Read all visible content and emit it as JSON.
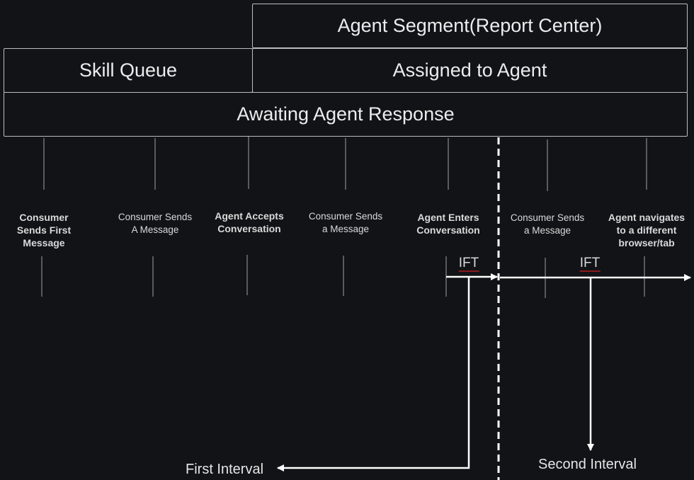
{
  "boxes": {
    "agent_segment": "Agent Segment(Report Center)",
    "skill_queue": "Skill Queue",
    "assigned_to_agent": "Assigned to Agent",
    "awaiting_agent_response": "Awaiting Agent Response"
  },
  "events": [
    {
      "line1": "Consumer",
      "line2": "Sends First",
      "line3": "Message",
      "bold": true
    },
    {
      "line1": "Consumer Sends",
      "line2": "A Message",
      "bold": false
    },
    {
      "line1": "Agent Accepts",
      "line2": "Conversation",
      "bold": true
    },
    {
      "line1": "Consumer Sends",
      "line2": "a Message",
      "bold": false
    },
    {
      "line1": "Agent Enters",
      "line2": "Conversation",
      "bold": true
    },
    {
      "line1": "Consumer Sends",
      "line2": "a Message",
      "bold": false
    },
    {
      "line1": "Agent navigates",
      "line2": "to a different",
      "line3": "browser/tab",
      "bold": true
    }
  ],
  "ift_labels": [
    "IFT",
    "IFT"
  ],
  "intervals": {
    "first": "First Interval",
    "second": "Second Interval"
  }
}
